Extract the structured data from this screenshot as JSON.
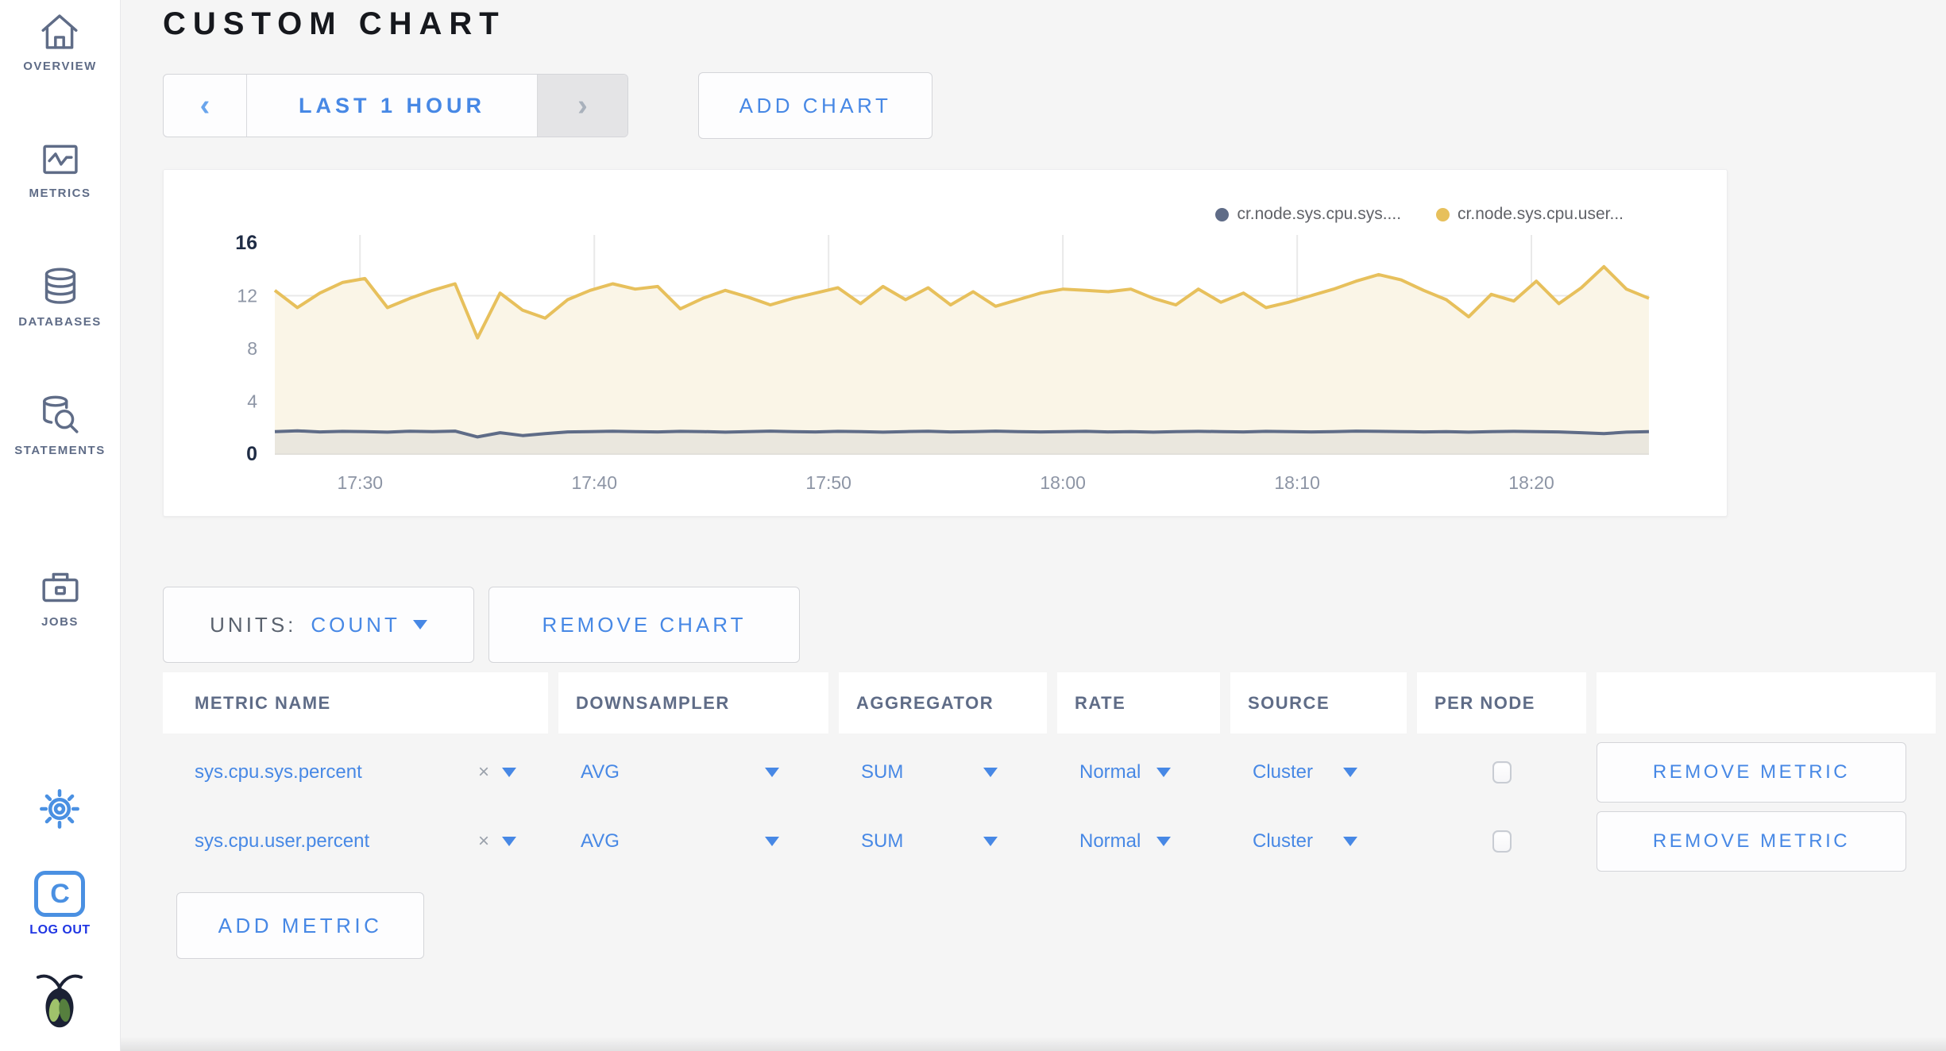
{
  "header": {
    "title": "CUSTOM CHART"
  },
  "icons": {
    "prev_arrow": "‹",
    "next_arrow": "›",
    "clear": "×",
    "logout_letter": "C"
  },
  "time_selector": {
    "label": "LAST 1 HOUR"
  },
  "buttons": {
    "add_chart": "ADD CHART",
    "remove_chart": "REMOVE CHART",
    "add_metric": "ADD METRIC",
    "remove_metric": "REMOVE METRIC"
  },
  "units": {
    "label": "UNITS:",
    "value": "COUNT"
  },
  "sidebar": {
    "items": [
      {
        "label": "OVERVIEW"
      },
      {
        "label": "METRICS"
      },
      {
        "label": "DATABASES"
      },
      {
        "label": "STATEMENTS"
      },
      {
        "label": "JOBS"
      }
    ],
    "logout_label": "LOG OUT"
  },
  "chart_data": {
    "type": "area",
    "title": "",
    "xlabel": "",
    "ylabel": "",
    "ylim": [
      0,
      16
    ],
    "y_ticks": [
      0,
      4,
      8,
      12,
      16
    ],
    "x_ticks": [
      "17:30",
      "17:40",
      "17:50",
      "18:00",
      "18:10",
      "18:20"
    ],
    "x_tick_fracs": [
      0.062,
      0.2325,
      0.403,
      0.5735,
      0.744,
      0.9145
    ],
    "grid": true,
    "legend_position": "top-right",
    "series": [
      {
        "name": "cr.node.sys.cpu.sys....",
        "color": "#5F6C87",
        "fill": "#EAE7DE",
        "values": [
          1.7,
          1.76,
          1.68,
          1.72,
          1.7,
          1.66,
          1.73,
          1.7,
          1.74,
          1.3,
          1.62,
          1.4,
          1.55,
          1.68,
          1.7,
          1.73,
          1.7,
          1.68,
          1.72,
          1.7,
          1.66,
          1.7,
          1.74,
          1.7,
          1.68,
          1.72,
          1.7,
          1.66,
          1.7,
          1.73,
          1.68,
          1.7,
          1.74,
          1.7,
          1.68,
          1.7,
          1.72,
          1.68,
          1.7,
          1.66,
          1.7,
          1.72,
          1.7,
          1.68,
          1.72,
          1.7,
          1.68,
          1.7,
          1.74,
          1.72,
          1.7,
          1.68,
          1.7,
          1.66,
          1.7,
          1.72,
          1.7,
          1.68,
          1.62,
          1.55,
          1.66,
          1.7
        ]
      },
      {
        "name": "cr.node.sys.cpu.user...",
        "color": "#E7C05C",
        "fill": "#FAF5E7",
        "values": [
          12.4,
          11.1,
          12.2,
          13.0,
          13.3,
          11.1,
          11.8,
          12.4,
          12.9,
          8.8,
          12.2,
          10.9,
          10.3,
          11.7,
          12.4,
          12.9,
          12.5,
          12.7,
          11.0,
          11.8,
          12.4,
          11.9,
          11.3,
          11.8,
          12.2,
          12.6,
          11.4,
          12.7,
          11.7,
          12.6,
          11.3,
          12.3,
          11.2,
          11.7,
          12.2,
          12.5,
          12.4,
          12.3,
          12.5,
          11.8,
          11.3,
          12.5,
          11.5,
          12.2,
          11.1,
          11.5,
          12.0,
          12.5,
          13.1,
          13.6,
          13.2,
          12.4,
          11.7,
          10.4,
          12.1,
          11.6,
          13.1,
          11.4,
          12.6,
          14.2,
          12.5,
          11.8
        ]
      }
    ]
  },
  "table": {
    "headers": [
      "METRIC NAME",
      "DOWNSAMPLER",
      "AGGREGATOR",
      "RATE",
      "SOURCE",
      "PER NODE"
    ],
    "rows": [
      {
        "metric": "sys.cpu.sys.percent",
        "downsampler": "AVG",
        "aggregator": "SUM",
        "rate": "Normal",
        "source": "Cluster",
        "per_node": false
      },
      {
        "metric": "sys.cpu.user.percent",
        "downsampler": "AVG",
        "aggregator": "SUM",
        "rate": "Normal",
        "source": "Cluster",
        "per_node": false
      }
    ]
  }
}
